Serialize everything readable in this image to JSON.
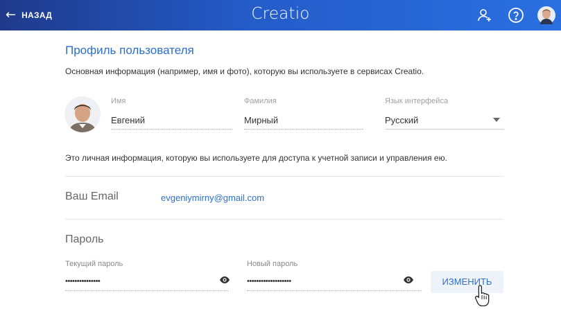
{
  "header": {
    "back_label": "НАЗАД",
    "logo_text": "Creatio",
    "icons": [
      "user-add-icon",
      "help-icon",
      "avatar"
    ],
    "colors": {
      "gradient_start": "#1f3a8a",
      "gradient_end": "#2a6fe0"
    }
  },
  "profile": {
    "title": "Профиль пользователя",
    "subtitle": "Основная информация (например, имя и фото), которую вы используете в сервисах Creatio.",
    "first_name": {
      "label": "Имя",
      "value": "Евгений"
    },
    "last_name": {
      "label": "Фамилия",
      "value": "Мирный"
    },
    "language": {
      "label": "Язык интерфейса",
      "value": "Русский"
    }
  },
  "account": {
    "info": "Это личная информация, которую вы используете для доступа к учетной записи и управления ею.",
    "email_label": "Ваш Email",
    "email_value": "evgeniymirny@gmail.com"
  },
  "password": {
    "title": "Пароль",
    "current": {
      "label": "Текущий пароль",
      "masked": "•••••••••••••••"
    },
    "new": {
      "label": "Новый пароль",
      "masked": "•••••••••••••••••••"
    },
    "change_label": "ИЗМЕНИТЬ"
  },
  "accent_color": "#2c6fcf"
}
